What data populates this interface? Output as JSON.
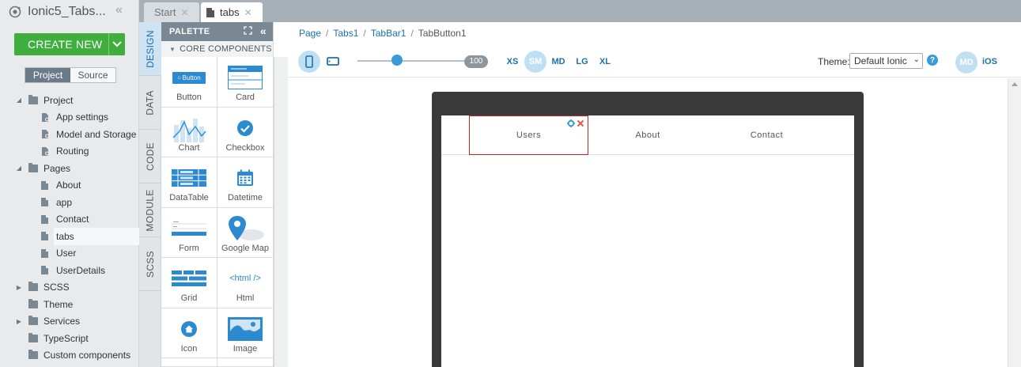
{
  "project": {
    "title": "Ionic5_Tabs...",
    "create_new": "CREATE NEW",
    "seg_project": "Project",
    "seg_source": "Source",
    "tree": [
      {
        "label": "Project",
        "level": 0,
        "type": "folder",
        "expanded": true
      },
      {
        "label": "App settings",
        "level": 1,
        "type": "settings"
      },
      {
        "label": "Model and Storage",
        "level": 1,
        "type": "settings"
      },
      {
        "label": "Routing",
        "level": 1,
        "type": "settings"
      },
      {
        "label": "Pages",
        "level": 0,
        "type": "folder",
        "expanded": true
      },
      {
        "label": "About",
        "level": 1,
        "type": "file"
      },
      {
        "label": "app",
        "level": 1,
        "type": "file"
      },
      {
        "label": "Contact",
        "level": 1,
        "type": "file"
      },
      {
        "label": "tabs",
        "level": 1,
        "type": "file",
        "selected": true
      },
      {
        "label": "User",
        "level": 1,
        "type": "file"
      },
      {
        "label": "UserDetails",
        "level": 1,
        "type": "file"
      },
      {
        "label": "SCSS",
        "level": 0,
        "type": "folder",
        "expandable": true
      },
      {
        "label": "Theme",
        "level": 0,
        "type": "folder"
      },
      {
        "label": "Services",
        "level": 0,
        "type": "folder",
        "expandable": true
      },
      {
        "label": "TypeScript",
        "level": 0,
        "type": "folder"
      },
      {
        "label": "Custom components",
        "level": 0,
        "type": "folder"
      }
    ]
  },
  "doc_tabs": {
    "start": "Start",
    "tabs": "tabs"
  },
  "side_tabs": [
    "DESIGN",
    "DATA",
    "CODE",
    "MODULE",
    "SCSS"
  ],
  "palette": {
    "header": "PALETTE",
    "section": "CORE COMPONENTS",
    "items": [
      {
        "label": "Button",
        "icon": "button-icon"
      },
      {
        "label": "Card",
        "icon": "card-icon"
      },
      {
        "label": "Chart",
        "icon": "chart-icon"
      },
      {
        "label": "Checkbox",
        "icon": "checkbox-icon"
      },
      {
        "label": "DataTable",
        "icon": "datatable-icon"
      },
      {
        "label": "Datetime",
        "icon": "calendar-icon"
      },
      {
        "label": "Form",
        "icon": "form-icon"
      },
      {
        "label": "Google Map",
        "icon": "map-pin-icon"
      },
      {
        "label": "Grid",
        "icon": "grid-icon"
      },
      {
        "label": "Html",
        "icon": "html-icon"
      },
      {
        "label": "Icon",
        "icon": "home-icon"
      },
      {
        "label": "Image",
        "icon": "image-icon"
      }
    ],
    "button_icon_text": "Button",
    "html_icon_text": "<html />"
  },
  "breadcrumb": [
    "Page",
    "Tabs1",
    "TabBar1",
    "TabButton1"
  ],
  "toolbar": {
    "zoom": "100",
    "breakpoints": [
      "XS",
      "SM",
      "MD",
      "LG",
      "XL"
    ],
    "selected_breakpoint": "SM",
    "theme_label": "Theme:",
    "theme_value": "Default Ionic",
    "help": "?",
    "mode_md": "MD",
    "mode_ios": "iOS"
  },
  "tabbar": {
    "buttons": [
      "Users",
      "About",
      "Contact"
    ],
    "selected": "Users"
  },
  "colors": {
    "accent": "#1b6fae",
    "create_green": "#3fae3f",
    "selection_red": "#cc1f1f",
    "device_frame": "#3a3a3a"
  }
}
